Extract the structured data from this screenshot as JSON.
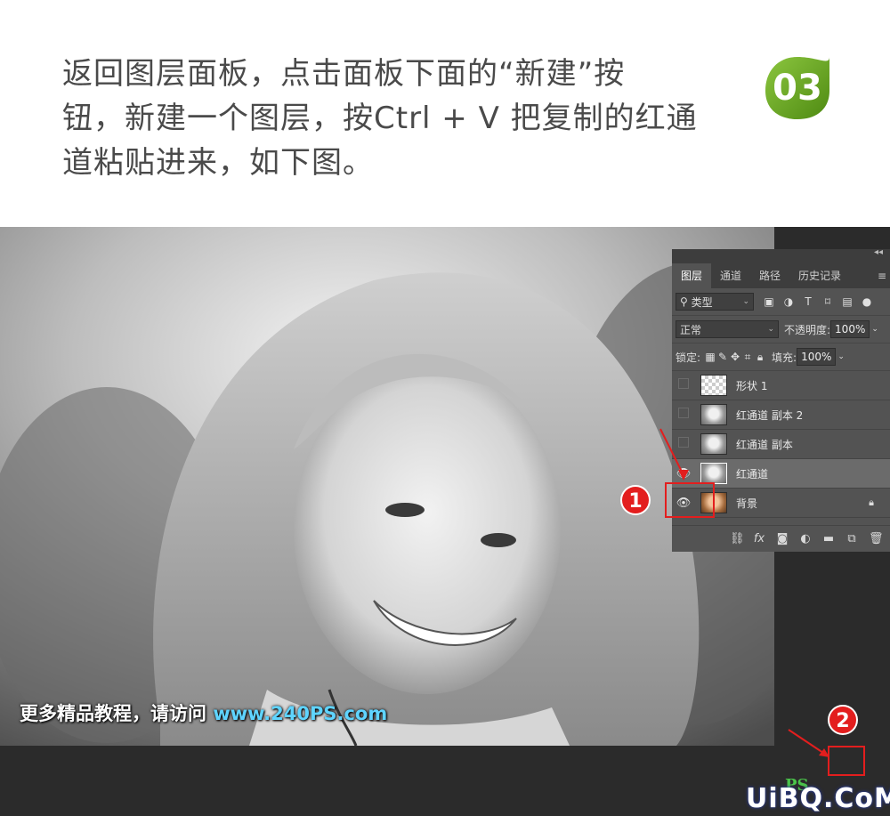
{
  "instruction": {
    "line1": "返回图层面板，点击面板下面的“新建”按",
    "line2": "钮，新建一个图层，按Ctrl + V 把复制的红通",
    "line3": "道粘贴进来，如下图。"
  },
  "step_badge": {
    "number": "03",
    "color": "#6aa51a"
  },
  "watermark": {
    "prefix": "更多精品教程，请访问 ",
    "url": "www.240PS.com"
  },
  "panel": {
    "tabs": [
      "图层",
      "通道",
      "路径",
      "历史记录"
    ],
    "active_tab": "图层",
    "filter_label": "类型",
    "blend_mode": "正常",
    "opacity_label": "不透明度:",
    "opacity_value": "100%",
    "lock_label": "锁定:",
    "fill_label": "填充:",
    "fill_value": "100%",
    "layers": [
      {
        "name": "形状 1",
        "visible": false,
        "thumb": "checker"
      },
      {
        "name": "红通道 副本 2",
        "visible": false,
        "thumb": "gray"
      },
      {
        "name": "红通道 副本",
        "visible": false,
        "thumb": "gray"
      },
      {
        "name": "红通道",
        "visible": true,
        "thumb": "gray",
        "selected": true
      },
      {
        "name": "背景",
        "visible": true,
        "thumb": "color",
        "locked": true
      }
    ]
  },
  "callouts": {
    "one": "1",
    "two": "2"
  },
  "footer": {
    "logo_text": "UiBQ.CoM",
    "ps_mark": "PS"
  },
  "colors": {
    "callout_red": "#e31e1e",
    "panel_bg": "#535353",
    "url_blue": "#5fd4ff"
  }
}
